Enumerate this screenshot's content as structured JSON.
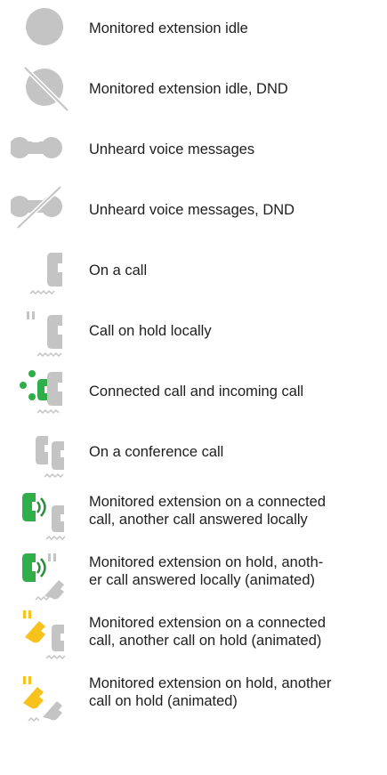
{
  "colors": {
    "grey": "#c4c4c4",
    "green": "#2fae49",
    "dark_green": "#2a8f3c",
    "yellow": "#f7c21c",
    "text": "#1e1e1e"
  },
  "legend": [
    {
      "icon": "idle-circle-icon",
      "lines": [
        "Monitored extension idle"
      ]
    },
    {
      "icon": "idle-dnd-icon",
      "lines": [
        "Monitored extension idle, DND"
      ]
    },
    {
      "icon": "voicemail-icon",
      "lines": [
        "Unheard voice messages"
      ]
    },
    {
      "icon": "voicemail-dnd-icon",
      "lines": [
        "Unheard voice messages, DND"
      ]
    },
    {
      "icon": "handset-icon",
      "lines": [
        "On a call"
      ]
    },
    {
      "icon": "handset-hold-icon",
      "lines": [
        "Call on hold locally"
      ]
    },
    {
      "icon": "handset-incoming-icon",
      "lines": [
        "Connected call and incoming call"
      ]
    },
    {
      "icon": "conference-icon",
      "lines": [
        "On a conference call"
      ]
    },
    {
      "icon": "green-handset-icon",
      "lines": [
        "Monitored extension on a connected",
        "call, another call answered locally"
      ]
    },
    {
      "icon": "green-handset-hold-icon",
      "lines": [
        "Monitored extension on hold, anoth-",
        "er call answered locally (animated)"
      ]
    },
    {
      "icon": "yellow-handset-icon",
      "lines": [
        "Monitored extension on a connected",
        "call, another call on hold (animated)"
      ]
    },
    {
      "icon": "yellow-handset-hold-icon",
      "lines": [
        "Monitored extension on hold, another",
        "call on hold (animated)"
      ]
    }
  ]
}
